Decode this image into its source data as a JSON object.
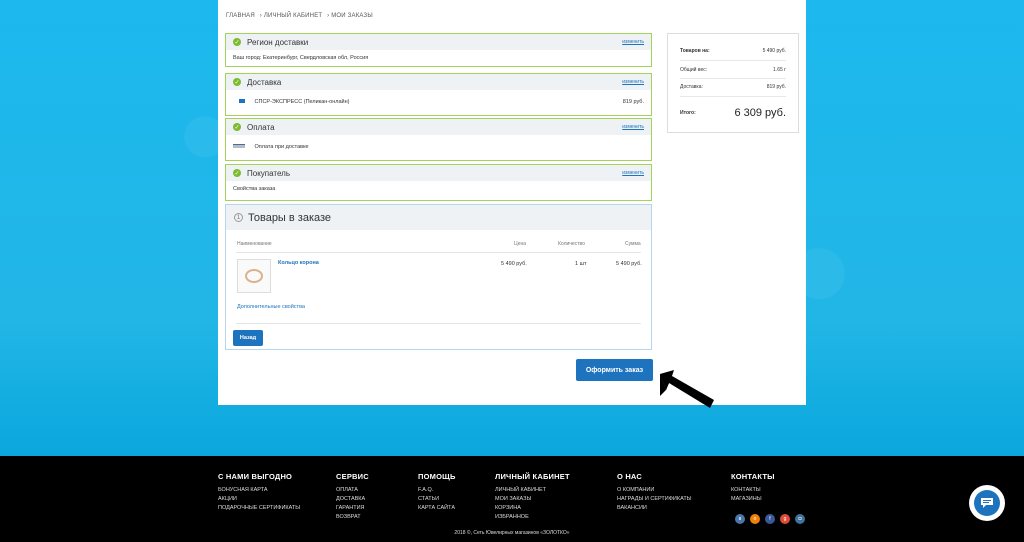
{
  "breadcrumb": [
    "ГЛАВНАЯ",
    "› ЛИЧНЫЙ КАБИНЕТ",
    "› МОИ ЗАКАЗЫ"
  ],
  "change_label": "изменить",
  "sections": {
    "region": {
      "title": "Регион доставки",
      "text": "Ваш город: Екатеринбург, Свердловская обл, Россия"
    },
    "delivery": {
      "title": "Доставка",
      "text": "СПСР-ЭКСПРЕСС (Пеликан-онлайн)",
      "price": "819 руб."
    },
    "payment": {
      "title": "Оплата",
      "text": "Оплата при доставке"
    },
    "buyer": {
      "title": "Покупатель",
      "text": "Свойства заказа"
    }
  },
  "goods": {
    "number": "1",
    "title": "Товары в заказе",
    "columns": [
      "Наименование",
      "Цена",
      "Количество",
      "Сумма"
    ],
    "item": {
      "name": "Кольцо корона",
      "price": "5 490 руб.",
      "qty": "1 шт",
      "sum": "5 490 руб."
    },
    "extra_link": "Дополнительные свойства",
    "back_button": "Назад"
  },
  "order_button": "Оформить заказ",
  "summary": {
    "goods_label": "Товаров на:",
    "goods_value": "5 490 руб.",
    "weight_label": "Общий вес:",
    "weight_value": "1.65 г",
    "delivery_label": "Доставка:",
    "delivery_value": "819 руб.",
    "total_label": "Итого:",
    "total_value": "6 309 руб."
  },
  "footer": {
    "col1": {
      "title": "С НАМИ ВЫГОДНО",
      "links": [
        "БОНУСНАЯ КАРТА",
        "АКЦИИ",
        "ПОДАРОЧНЫЕ СЕРТИФИКАТЫ"
      ]
    },
    "col2": {
      "title": "СЕРВИС",
      "links": [
        "ОПЛАТА",
        "ДОСТАВКА",
        "ГАРАНТИЯ",
        "ВОЗВРАТ"
      ]
    },
    "col3": {
      "title": "ПОМОЩЬ",
      "links": [
        "F.A.Q.",
        "СТАТЬИ",
        "КАРТА САЙТА"
      ]
    },
    "col4": {
      "title": "ЛИЧНЫЙ КАБИНЕТ",
      "links": [
        "ЛИЧНЫЙ КАБИНЕТ",
        "МОИ ЗАКАЗЫ",
        "КОРЗИНА",
        "ИЗБРАННОЕ"
      ]
    },
    "col5": {
      "title": "О НАС",
      "links": [
        "О КОМПАНИИ",
        "НАГРАДЫ И СЕРТИФИКАТЫ",
        "ВАКАНСИИ"
      ]
    },
    "col6": {
      "title": "КОНТАКТЫ",
      "links": [
        "КОНТАКТЫ",
        "МАГАЗИНЫ"
      ]
    },
    "copyright": "2018 ©, Сеть Ювелирных магазинов «ЗОЛОТКО»"
  },
  "colors": {
    "accent": "#1e73be",
    "success": "#7dbb2f",
    "background": "#1fb6ea"
  },
  "icons": {
    "check": "check-icon",
    "chat": "chat-icon",
    "arrow": "arrow-pointer"
  }
}
